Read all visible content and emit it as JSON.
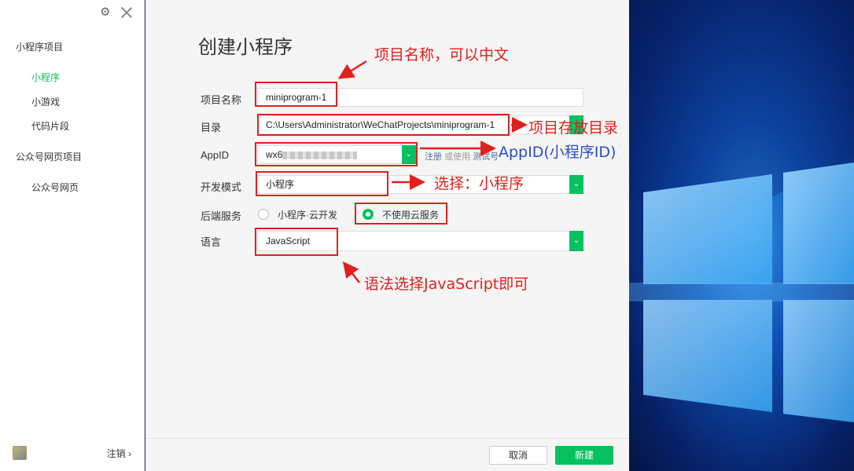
{
  "sidebar": {
    "group_miniprogram": "小程序项目",
    "items": [
      {
        "label": "小程序",
        "active": true
      },
      {
        "label": "小游戏",
        "active": false
      },
      {
        "label": "代码片段",
        "active": false
      }
    ],
    "group_official": "公众号网页项目",
    "official_item": "公众号网页",
    "logout_label": "注销",
    "logout_chevron": "›",
    "icons": {
      "settings": "gear-icon",
      "close": "close-icon",
      "avatar": "user-avatar"
    }
  },
  "form": {
    "title": "创建小程序",
    "project_name": {
      "label": "项目名称",
      "value": "miniprogram-1"
    },
    "directory": {
      "label": "目录",
      "value": "C:\\Users\\Administrator\\WeChatProjects\\miniprogram-1"
    },
    "appid": {
      "label": "AppID",
      "value": "wx6",
      "link_register": "注册",
      "link_or": "或使用",
      "link_test": "测试号"
    },
    "dev_mode": {
      "label": "开发模式",
      "value": "小程序"
    },
    "backend": {
      "label": "后端服务",
      "options": [
        {
          "label": "小程序·云开发",
          "selected": false
        },
        {
          "label": "不使用云服务",
          "selected": true
        }
      ]
    },
    "language": {
      "label": "语言",
      "value": "JavaScript"
    },
    "dropdown_glyph": "⌄"
  },
  "footer": {
    "cancel_label": "取消",
    "create_label": "新建"
  },
  "annotations": {
    "project_name_note": "项目名称，可以中文",
    "directory_note": "项目存放目录",
    "appid_note": "AppID(小程序ID)",
    "mode_note": "选择：小程序",
    "language_note": "语法选择JavaScript即可"
  },
  "colors": {
    "accent": "#07c160",
    "annotation": "#e0201c",
    "link": "#576b95"
  }
}
